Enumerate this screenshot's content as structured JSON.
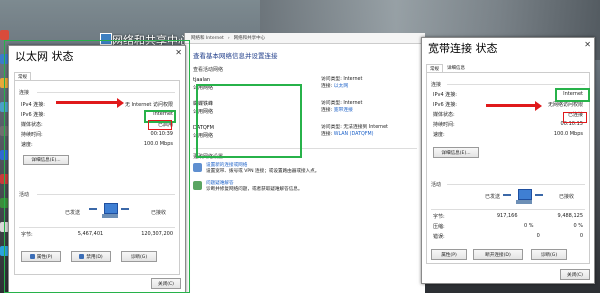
{
  "nsc": {
    "title": "网络和共享中心",
    "address": [
      "网络和 Internet",
      "网络和共享中心"
    ],
    "heading": "查看基本网络信息并设置连接",
    "active_label": "查看活动网络",
    "networks": [
      {
        "name": "tjaalan",
        "type": "公用网络",
        "access_label": "访问类型:",
        "access": "Internet",
        "conn_label": "连接:",
        "conn": "以太网"
      },
      {
        "name": "蝴蝶铁峰",
        "type": "公用网络",
        "access_label": "访问类型:",
        "access": "Internet",
        "conn_label": "连接:",
        "conn": "宽带连接"
      },
      {
        "name": "DATQFM",
        "type": "公用网络",
        "access_label": "访问类型:",
        "access": "无法连接到 Internet",
        "conn_label": "连接:",
        "conn": "WLAN (DATQFM)"
      }
    ],
    "change_label": "更改网络设置",
    "settings": [
      {
        "title": "设置新的连接或网络",
        "desc": "设置宽带、拨号或 VPN 连接；或设置路由器或接入点。"
      },
      {
        "title": "问题疑难解答",
        "desc": "诊断并修复网络问题，或者获取疑难解答信息。"
      }
    ]
  },
  "eth": {
    "title": "以太网 状态",
    "close": "✕",
    "tab": "常规",
    "conn_group": "连接",
    "rows": [
      {
        "k": "IPv4 连接:",
        "v": "无 Internet 访问权限"
      },
      {
        "k": "IPv6 连接:",
        "v": "Internet"
      },
      {
        "k": "媒体状态:",
        "v": "已启用"
      },
      {
        "k": "持续时间:",
        "v": "00:10:39"
      },
      {
        "k": "速度:",
        "v": "100.0 Mbps"
      }
    ],
    "details_btn": "详细信息(E)...",
    "activity_group": "活动",
    "sent": "已发送",
    "received": "已接收",
    "bytes_label": "字节:",
    "bytes_sent": "5,467,401",
    "bytes_recv": "120,307,200",
    "btn_props": "属性(P)",
    "btn_disable": "禁用(D)",
    "btn_diag": "诊断(G)",
    "btn_close": "关闭(C)"
  },
  "bb": {
    "title": "宽带连接 状态",
    "close": "✕",
    "tabs": [
      "常规",
      "详细信息"
    ],
    "conn_group": "连接",
    "rows": [
      {
        "k": "IPv4 连接:",
        "v": "Internet"
      },
      {
        "k": "IPv6 连接:",
        "v": "无网络访问权限"
      },
      {
        "k": "媒体状态:",
        "v": "已连接"
      },
      {
        "k": "持续时间:",
        "v": "00:10:15"
      },
      {
        "k": "速度:",
        "v": "100.0 Mbps"
      }
    ],
    "details_btn": "详细信息(E)...",
    "activity_group": "活动",
    "sent": "已发送",
    "received": "已接收",
    "stats": [
      {
        "k": "字节:",
        "a": "917,166",
        "b": "9,488,125"
      },
      {
        "k": "压缩:",
        "a": "0 %",
        "b": "0 %"
      },
      {
        "k": "错误:",
        "a": "0",
        "b": "0"
      }
    ],
    "btn_props": "属性(P)",
    "btn_disconnect": "断开连接(D)",
    "btn_diag": "诊断(G)",
    "btn_close": "关闭(C)"
  },
  "colors": {
    "red": "#e0191b",
    "green": "#27b24a",
    "link": "#1d62c9"
  }
}
